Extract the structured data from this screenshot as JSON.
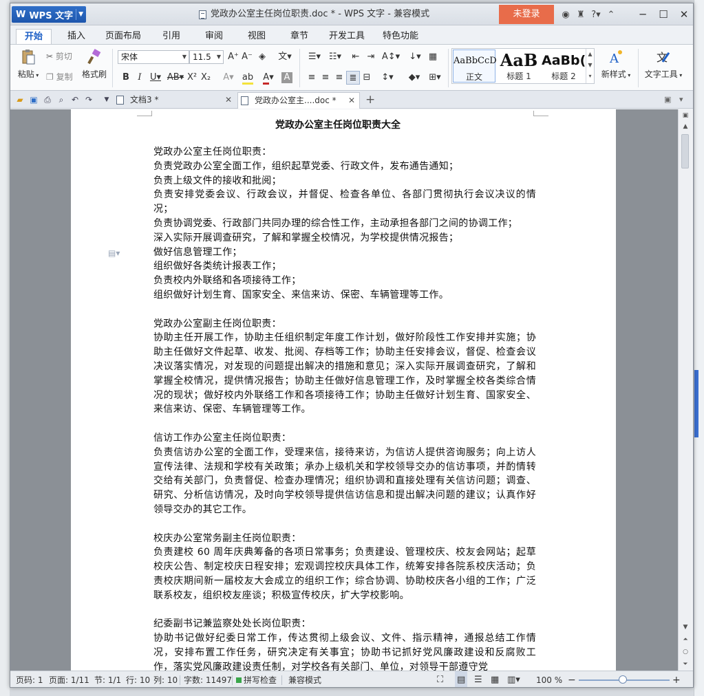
{
  "window": {
    "app_name": "WPS 文字",
    "title": "党政办公室主任岗位职责.doc * - WPS 文字 - 兼容模式",
    "login": "未登录"
  },
  "ribbon_tabs": [
    "开始",
    "插入",
    "页面布局",
    "引用",
    "审阅",
    "视图",
    "章节",
    "开发工具",
    "特色功能"
  ],
  "ribbon": {
    "paste": "粘贴",
    "cut": "剪切",
    "copy": "复制",
    "format_painter": "格式刷",
    "font_name": "宋体",
    "font_size": "11.5",
    "styles": [
      {
        "preview": "AaBbCcD",
        "name": "正文"
      },
      {
        "preview": "AaB",
        "name": "标题 1"
      },
      {
        "preview": "AaBb(",
        "name": "标题 2"
      }
    ],
    "new_style": "新样式",
    "text_tools": "文字工具"
  },
  "doc_tabs": [
    {
      "label": "文档3 *",
      "active": false
    },
    {
      "label": "党政办公室主....doc *",
      "active": true
    }
  ],
  "document": {
    "title": "党政办公室主任岗位职责大全",
    "paragraphs": [
      "党政办公室主任岗位职责：",
      "负责党政办公室全面工作，组织起草党委、行政文件，发布通告通知；",
      "负责上级文件的接收和批阅；",
      "负责安排党委会议、行政会议，并督促、检查各单位、各部门贯彻执行会议决议的情况；",
      "负责协调党委、行政部门共同办理的综合性工作，主动承担各部门之间的协调工作；",
      "深入实际开展调查研究，了解和掌握全校情况，为学校提供情况报告；",
      "做好信息管理工作；",
      "组织做好各类统计报表工作；",
      "负责校内外联络和各项接待工作；",
      "组织做好计划生育、国家安全、来信来访、保密、车辆管理等工作。",
      "",
      "党政办公室副主任岗位职责：",
      "协助主任开展工作，协助主任组织制定年度工作计划，做好阶段性工作安排并实施；协助主任做好文件起草、收发、批阅、存档等工作；协助主任安排会议，督促、检查会议决议落实情况，对发现的问题提出解决的措施和意见；深入实际开展调查研究，了解和掌握全校情况，提供情况报告；协助主任做好信息管理工作，及时掌握全校各类综合情况的现状；做好校内外联络工作和各项接待工作；协助主任做好计划生育、国家安全、来信来访、保密、车辆管理等工作。",
      "",
      "信访工作办公室主任岗位职责：",
      "负责信访办公室的全面工作，受理来信，接待来访，为信访人提供咨询服务；向上访人宣传法律、法规和学校有关政策；承办上级机关和学校领导交办的信访事项，并酌情转交给有关部门，负责督促、检查办理情况；组织协调和直接处理有关信访问题；调查、研究、分析信访情况，及时向学校领导提供信访信息和提出解决问题的建议；认真作好领导交办的其它工作。",
      "",
      "校庆办公室常务副主任岗位职责：",
      "负责建校 60 周年庆典筹备的各项日常事务；负责建设、管理校庆、校友会网站；起草校庆公告、制定校庆日程安排；宏观调控校庆具体工作，统筹安排各院系校庆活动；负责校庆期间新一届校友大会成立的组织工作；综合协调、协助校庆各小组的工作；广泛联系校友，组织校友座谈；积极宣传校庆，扩大学校影响。",
      "",
      "纪委副书记兼监察处处长岗位职责：",
      "协助书记做好纪委日常工作，传达贯彻上级会议、文件、指示精神，通报总结工作情况，安排布置工作任务，研究决定有关事宜；协助书记抓好党风廉政建设和反腐败工作，落实党风廉政建设责任制，对学校各有关部门、单位，对领导干部遵守党"
    ]
  },
  "status": {
    "page_code": "页码: 1",
    "pages": "页面: 1/11",
    "section": "节: 1/1",
    "row": "行: 10",
    "col": "列: 10",
    "word_count": "字数: 11497",
    "spell_check": "拼写检查",
    "compat_mode": "兼容模式",
    "zoom": "100 %"
  }
}
